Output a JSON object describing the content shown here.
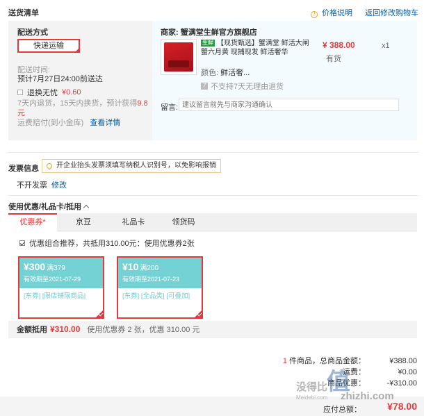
{
  "header": {
    "title": "送货清单",
    "price_note": "价格说明",
    "back_cart": "返回修改购物车"
  },
  "shipping": {
    "title": "配送方式",
    "method": "快递运输",
    "time_label": "配送时间:",
    "time_value": "预计7月27日24:00前送达",
    "return_label": "退换无忧",
    "return_price": "¥0.60",
    "return_note_a": "7天内退货，15天内换货，预计获得",
    "return_note_b": "9.8元",
    "return_note_c": "运费赔付(到小金库)",
    "details_link": "查看详情"
  },
  "product": {
    "seller_label": "商家:",
    "seller_name": "蟹满堂生鲜官方旗舰店",
    "tag": "生鲜",
    "name": "【现货甄选】蟹满堂 鲜活大闸蟹六月黄 现捕现发 鲜活奢华",
    "price": "¥ 388.00",
    "stock": "有货",
    "qty": "x1",
    "color_label": "颜色:",
    "color_value": "鲜活奢...",
    "no_return": "不支持7天无理由退货",
    "message_label": "留言:",
    "message_placeholder": "建议留言前先与商家沟通确认"
  },
  "invoice": {
    "title": "发票信息",
    "tip": "开企业抬头发票须填写纳税人识别号，以免影响报销",
    "value": "不开发票",
    "edit": "修改"
  },
  "coupons": {
    "title": "使用优惠/礼品卡/抵用",
    "tabs": [
      {
        "label": "优惠券"
      },
      {
        "label": "京豆"
      },
      {
        "label": "礼品卡"
      },
      {
        "label": "领货码"
      }
    ],
    "combo": "优惠组合推荐，共抵用310.00元：使用优惠券2张",
    "items": [
      {
        "amount": "¥300",
        "cond": "满379",
        "expiry": "有效期至2021-07-29",
        "tags": "[东券] [限店铺限商品]"
      },
      {
        "amount": "¥10",
        "cond": "满200",
        "expiry": "有效期至2021-07-23",
        "tags": "[东券] [全品类] [可叠加]"
      }
    ],
    "sum_label": "金额抵用",
    "sum_amount": "¥310.00",
    "sum_desc": "使用优惠券 2 张，优惠 310.00 元"
  },
  "totals": {
    "items_count": "1",
    "items_label": "件商品，总商品金额：",
    "items_value": "¥388.00",
    "freight_label": "运费：",
    "freight_value": "¥0.00",
    "discount_label": "商品优惠：",
    "discount_value": "-¥310.00",
    "pay_label": "应付总额：",
    "pay_value": "¥78.00"
  },
  "watermark": {
    "big": "值",
    "cn": "没得比",
    "url": "zhizhi.com",
    "small": "Meidebi.com"
  },
  "colors": {
    "accent": "#e4393c",
    "link": "#005ea7",
    "coupon": "#74d2d4"
  }
}
